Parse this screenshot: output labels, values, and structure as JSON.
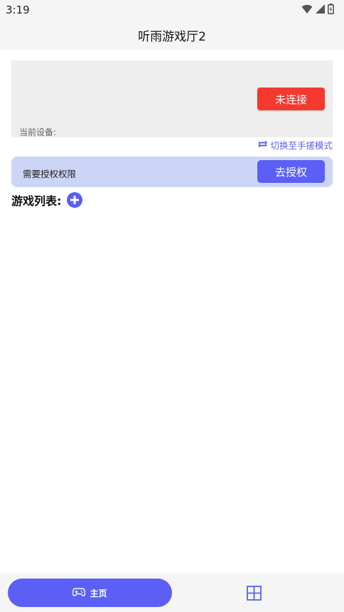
{
  "status_bar": {
    "time": "3:19",
    "icons": [
      "wifi-icon",
      "signal-icon",
      "battery-icon"
    ]
  },
  "app_bar": {
    "title": "听雨游戏厅2"
  },
  "device_card": {
    "connect_button": "未连接",
    "current_device_label": "当前设备:"
  },
  "switch_mode": {
    "icon": "repeat-icon",
    "label": "切换至手搓模式"
  },
  "auth_bar": {
    "message": "需要授权权限",
    "button": "去授权"
  },
  "games": {
    "title": "游戏列表:",
    "add_icon": "add-circle-icon"
  },
  "bottom_nav": {
    "home": {
      "icon": "gamepad-icon",
      "label": "主页"
    },
    "second": {
      "icon": "grid-icon"
    }
  },
  "colors": {
    "accent": "#5b5ff5",
    "danger": "#f4392f",
    "auth_bg": "#cdd5f7"
  }
}
